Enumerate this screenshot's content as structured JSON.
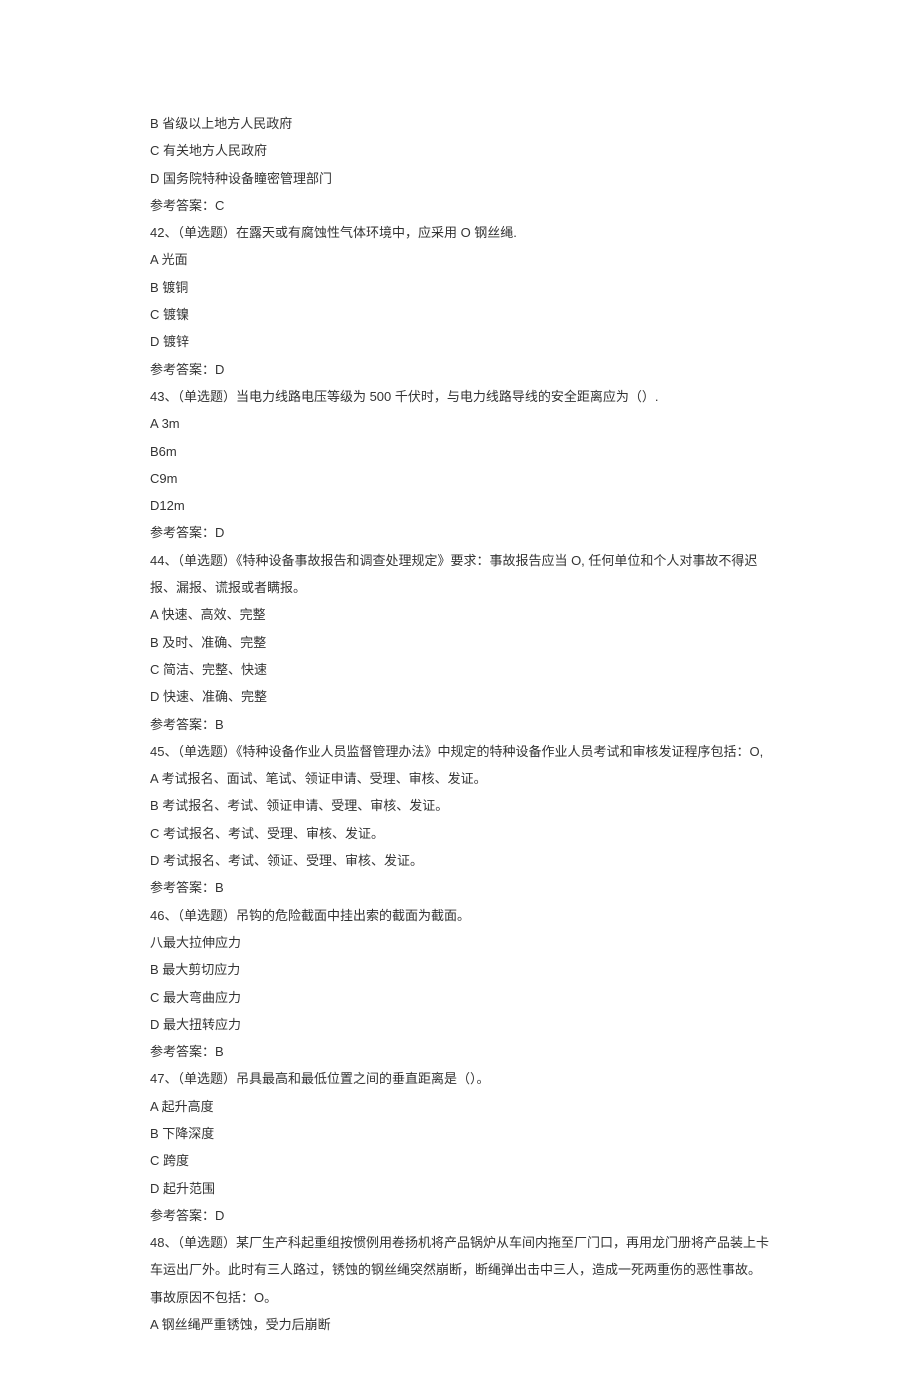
{
  "lines": [
    "B 省级以上地方人民政府",
    "C 有关地方人民政府",
    "D 国务院特种设备瞳密管理部门",
    "参考答案：C",
    "42、（单选题）在露天或有腐蚀性气体环境中，应采用 O 钢丝绳.",
    "A 光面",
    "B 镀铜",
    "C 镀镍",
    "D 镀锌",
    "参考答案：D",
    "43、（单选题）当电力线路电压等级为 500 千伏时，与电力线路导线的安全距离应为（）.",
    "A 3m",
    "B6m",
    "C9m",
    "D12m",
    "参考答案：D",
    "44、（单选题）《特种设备事故报告和调查处理规定》要求：事故报告应当 O, 任何单位和个人对事故不得迟报、漏报、谎报或者瞒报。",
    "A 快速、高效、完整",
    "B 及时、准确、完整",
    "C 简洁、完整、快速",
    "D 快速、准确、完整",
    "参考答案：B",
    "45、（单选题）《特种设备作业人员监督管理办法》中规定的特种设备作业人员考试和审核发证程序包括：O, A 考试报名、面试、笔试、领证申请、受理、审核、发证。",
    "B 考试报名、考试、领证申请、受理、审核、发证。",
    "C 考试报名、考试、受理、审核、发证。",
    "D 考试报名、考试、领证、受理、审核、发证。",
    "参考答案：B",
    "46、（单选题）吊钩的危险截面中挂出索的截面为截面。",
    "八最大拉伸应力",
    "B 最大剪切应力",
    "C 最大弯曲应力",
    "D 最大扭转应力",
    "参考答案：B",
    "47、（单选题）吊具最高和最低位置之间的垂直距离是（）。",
    "A 起升高度",
    "B 下降深度",
    "C 跨度",
    "D 起升范围",
    "参考答案：D",
    "48、（单选题）某厂生产科起重组按惯例用卷扬机将产品锅炉从车间内拖至厂门口，再用龙门册将产品装上卡车运出厂外。此时有三人路过，锈蚀的钢丝绳突然崩断，断绳弹出击中三人，造成一死两重伤的恶性事故。事故原因不包括：O。",
    "A 钢丝绳严重锈蚀，受力后崩断"
  ]
}
